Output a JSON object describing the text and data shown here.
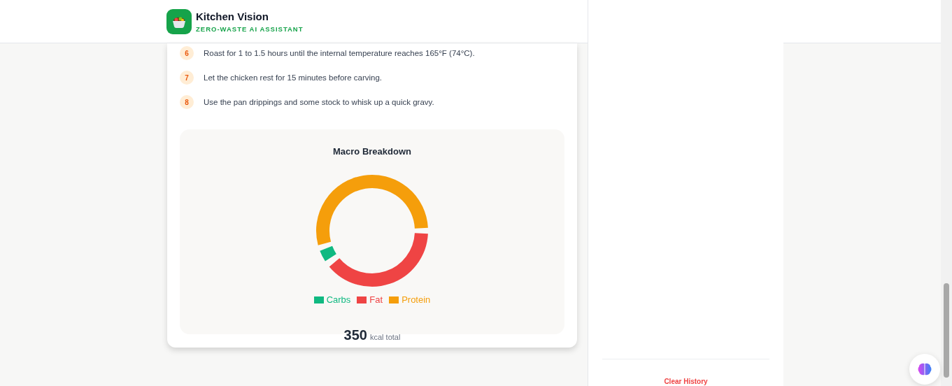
{
  "header": {
    "title": "Kitchen Vision",
    "subtitle": "ZERO-WASTE AI ASSISTANT"
  },
  "steps": [
    {
      "number": "6",
      "text": "Roast for 1 to 1.5 hours until the internal temperature reaches 165°F (74°C)."
    },
    {
      "number": "7",
      "text": "Let the chicken rest for 15 minutes before carving."
    },
    {
      "number": "8",
      "text": "Use the pan drippings and some stock to whisk up a quick gravy."
    }
  ],
  "macro": {
    "title": "Macro Breakdown",
    "legend": [
      {
        "label": "Carbs",
        "color": "#10b981"
      },
      {
        "label": "Fat",
        "color": "#ef4444"
      },
      {
        "label": "Protein",
        "color": "#f59e0b"
      }
    ],
    "total": {
      "value": "350",
      "unit": "kcal total"
    }
  },
  "sidebar": {
    "action": "Clear History"
  }
}
